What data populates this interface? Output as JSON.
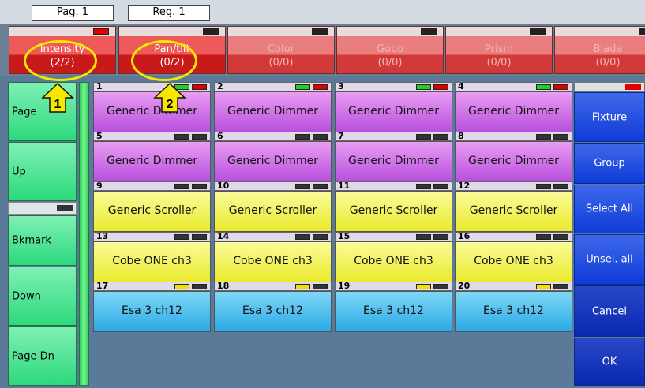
{
  "topbar": {
    "page_label": "Pag. 1",
    "reg_label": "Reg. 1"
  },
  "tabs": [
    {
      "label": "Intensity",
      "count": "(2/2)",
      "indicator": "#e00000",
      "state": "active"
    },
    {
      "label": "Pan/tilt",
      "count": "(0/2)",
      "indicator": "#222222",
      "state": "active"
    },
    {
      "label": "Color",
      "count": "(0/0)",
      "indicator": "#222222",
      "state": "dim"
    },
    {
      "label": "Gobo",
      "count": "(0/0)",
      "indicator": "#222222",
      "state": "dim"
    },
    {
      "label": "Prism",
      "count": "(0/0)",
      "indicator": "#222222",
      "state": "dim"
    },
    {
      "label": "Blade",
      "count": "(0/0)",
      "indicator": "#222222",
      "state": "dim"
    }
  ],
  "left_buttons": [
    "Page",
    "Up",
    "Bkmark",
    "Down",
    "Page Dn"
  ],
  "fixtures": [
    {
      "num": "1",
      "name": "Generic Dimmer",
      "color": "purple",
      "ind_a": "#20d020",
      "ind_b": "#e00000"
    },
    {
      "num": "2",
      "name": "Generic Dimmer",
      "color": "purple",
      "ind_a": "#20d020",
      "ind_b": "#e00000"
    },
    {
      "num": "3",
      "name": "Generic Dimmer",
      "color": "purple",
      "ind_a": "#20d020",
      "ind_b": "#e00000"
    },
    {
      "num": "4",
      "name": "Generic Dimmer",
      "color": "purple",
      "ind_a": "#20d020",
      "ind_b": "#e00000"
    },
    {
      "num": "5",
      "name": "Generic Dimmer",
      "color": "purple",
      "ind_a": "#333333",
      "ind_b": "#333333"
    },
    {
      "num": "6",
      "name": "Generic Dimmer",
      "color": "purple",
      "ind_a": "#333333",
      "ind_b": "#333333"
    },
    {
      "num": "7",
      "name": "Generic Dimmer",
      "color": "purple",
      "ind_a": "#333333",
      "ind_b": "#333333"
    },
    {
      "num": "8",
      "name": "Generic Dimmer",
      "color": "purple",
      "ind_a": "#333333",
      "ind_b": "#333333"
    },
    {
      "num": "9",
      "name": "Generic Scroller",
      "color": "yellow",
      "ind_a": "#333333",
      "ind_b": "#333333"
    },
    {
      "num": "10",
      "name": "Generic Scroller",
      "color": "yellow",
      "ind_a": "#333333",
      "ind_b": "#333333"
    },
    {
      "num": "11",
      "name": "Generic Scroller",
      "color": "yellow",
      "ind_a": "#333333",
      "ind_b": "#333333"
    },
    {
      "num": "12",
      "name": "Generic Scroller",
      "color": "yellow",
      "ind_a": "#333333",
      "ind_b": "#333333"
    },
    {
      "num": "13",
      "name": "Cobe ONE ch3",
      "color": "yellow",
      "ind_a": "#333333",
      "ind_b": "#333333"
    },
    {
      "num": "14",
      "name": "Cobe ONE ch3",
      "color": "yellow",
      "ind_a": "#333333",
      "ind_b": "#333333"
    },
    {
      "num": "15",
      "name": "Cobe ONE ch3",
      "color": "yellow",
      "ind_a": "#333333",
      "ind_b": "#333333"
    },
    {
      "num": "16",
      "name": "Cobe ONE ch3",
      "color": "yellow",
      "ind_a": "#333333",
      "ind_b": "#333333"
    },
    {
      "num": "17",
      "name": "Esa 3 ch12",
      "color": "blue",
      "ind_a": "#f0e000",
      "ind_b": "#333333"
    },
    {
      "num": "18",
      "name": "Esa 3 ch12",
      "color": "blue",
      "ind_a": "#f0e000",
      "ind_b": "#333333"
    },
    {
      "num": "19",
      "name": "Esa 3 ch12",
      "color": "blue",
      "ind_a": "#f0e000",
      "ind_b": "#333333"
    },
    {
      "num": "20",
      "name": "Esa 3 ch12",
      "color": "blue",
      "ind_a": "#f0e000",
      "ind_b": "#333333"
    }
  ],
  "right_buttons": [
    "Fixture",
    "Group",
    "Select All",
    "Unsel. all",
    "Cancel",
    "OK"
  ],
  "annotations": [
    "1",
    "2"
  ],
  "colors": {
    "highlight": "#f5e800",
    "selected_indicator": "#e00000",
    "active_indicator": "#20d020"
  }
}
